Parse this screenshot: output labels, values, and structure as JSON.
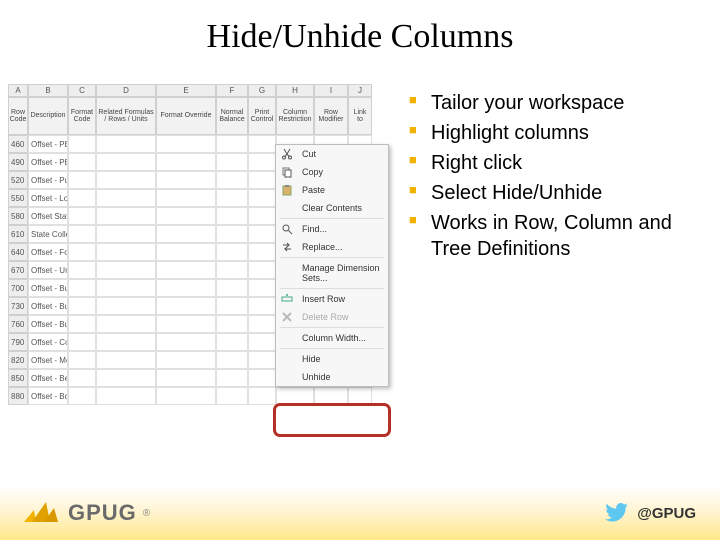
{
  "title": "Hide/Unhide Columns",
  "bullets": [
    "Tailor your workspace",
    "Highlight columns",
    "Right click",
    "Select Hide/Unhide",
    "Works in Row, Column and Tree Definitions"
  ],
  "screenshot": {
    "col_letters": [
      "A",
      "B",
      "C",
      "D",
      "E",
      "F",
      "G",
      "H",
      "I",
      "J"
    ],
    "col_names": [
      "Row Code",
      "Description",
      "Format Code",
      "Related Formulas / Rows / Units",
      "Format Override",
      "Normal Balance",
      "Print Control",
      "Column Restriction",
      "Row Modifier",
      "Link to"
    ],
    "rows": [
      {
        "code": "460",
        "desc": "Offset - PB.."
      },
      {
        "code": "490",
        "desc": "Offset - PB.."
      },
      {
        "code": "520",
        "desc": "Offset - Pu.."
      },
      {
        "code": "550",
        "desc": "Offset - Loc.."
      },
      {
        "code": "580",
        "desc": "Offset Stat.."
      },
      {
        "code": "610",
        "desc": "State Colle.."
      },
      {
        "code": "640",
        "desc": "Offset - Fou.."
      },
      {
        "code": "670",
        "desc": "Offset - Uni.."
      },
      {
        "code": "700",
        "desc": "Offset - Bu.."
      },
      {
        "code": "730",
        "desc": "Offset - Bu.."
      },
      {
        "code": "760",
        "desc": "Offset - Bu.."
      },
      {
        "code": "790",
        "desc": "Offset - Co.."
      },
      {
        "code": "820",
        "desc": "Offset - Me.."
      },
      {
        "code": "850",
        "desc": "Offset - Be.."
      },
      {
        "code": "880",
        "desc": "Offset - Bo.."
      }
    ],
    "context_menu": [
      {
        "label": "Cut",
        "icon": "cut-icon"
      },
      {
        "label": "Copy",
        "icon": "copy-icon"
      },
      {
        "label": "Paste",
        "icon": "paste-icon"
      },
      {
        "label": "Clear Contents",
        "icon": ""
      },
      {
        "sep": true
      },
      {
        "label": "Find...",
        "icon": "find-icon"
      },
      {
        "label": "Replace...",
        "icon": "replace-icon"
      },
      {
        "sep": true
      },
      {
        "label": "Manage Dimension Sets...",
        "icon": ""
      },
      {
        "sep": true
      },
      {
        "label": "Insert Row",
        "icon": "insert-row-icon"
      },
      {
        "label": "Delete Row",
        "icon": "delete-row-icon",
        "disabled": true
      },
      {
        "sep": true
      },
      {
        "label": "Column Width...",
        "icon": ""
      },
      {
        "sep": true
      },
      {
        "label": "Hide",
        "icon": ""
      },
      {
        "label": "Unhide",
        "icon": ""
      }
    ]
  },
  "footer": {
    "logo_text": "GPUG",
    "registered": "®",
    "twitter_handle": "@GPUG"
  },
  "colors": {
    "accent_orange": "#f2b200",
    "highlight_red": "#b53026",
    "twitter_blue": "#5dc7ef"
  }
}
